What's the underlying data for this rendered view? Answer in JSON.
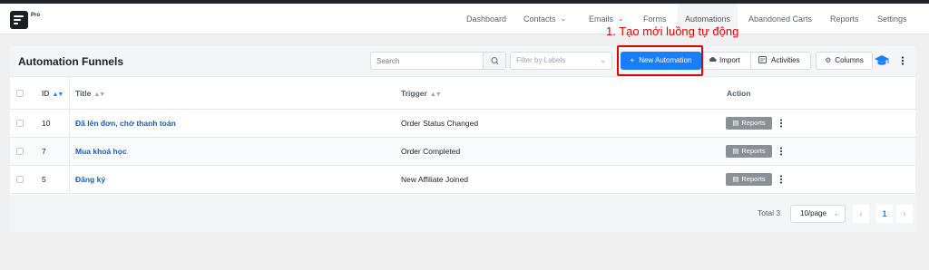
{
  "app": {
    "logo_text": "Pro"
  },
  "nav": {
    "items": [
      {
        "label": "Dashboard"
      },
      {
        "label": "Contacts",
        "caret": "⌄"
      },
      {
        "label": "Emails",
        "caret": "⌄"
      },
      {
        "label": "Forms"
      },
      {
        "label": "Automations",
        "active": true
      },
      {
        "label": "Abandoned Carts"
      },
      {
        "label": "Reports"
      },
      {
        "label": "Settings"
      }
    ]
  },
  "annotation": {
    "text": "1. Tạo mới luồng tự động",
    "color": "#e00000"
  },
  "page": {
    "title": "Automation Funnels",
    "search_placeholder": "Search",
    "filter_placeholder": "Filter by Labels",
    "new_button": "New Automation",
    "import_button": "Import",
    "activities_button": "Activities",
    "columns_button": "Columns"
  },
  "table": {
    "headers": {
      "id": "ID",
      "title": "Title",
      "trigger": "Trigger",
      "action": "Action"
    },
    "rows": [
      {
        "id": "10",
        "title": "Đã lên đơn, chờ thanh toán",
        "trigger": "Order Status Changed",
        "action_label": "Reports"
      },
      {
        "id": "7",
        "title": "Mua khoá học",
        "trigger": "Order Completed",
        "action_label": "Reports"
      },
      {
        "id": "5",
        "title": "Đăng ký",
        "trigger": "New Affiliate Joined",
        "action_label": "Reports"
      }
    ]
  },
  "pagination": {
    "total_label": "Total 3",
    "page_size": "10/page",
    "current_page": "1",
    "prev": "‹",
    "next": "›"
  },
  "colors": {
    "primary": "#1a7efb",
    "link": "#1a5fb4",
    "reports_button": "#8b8f96"
  }
}
